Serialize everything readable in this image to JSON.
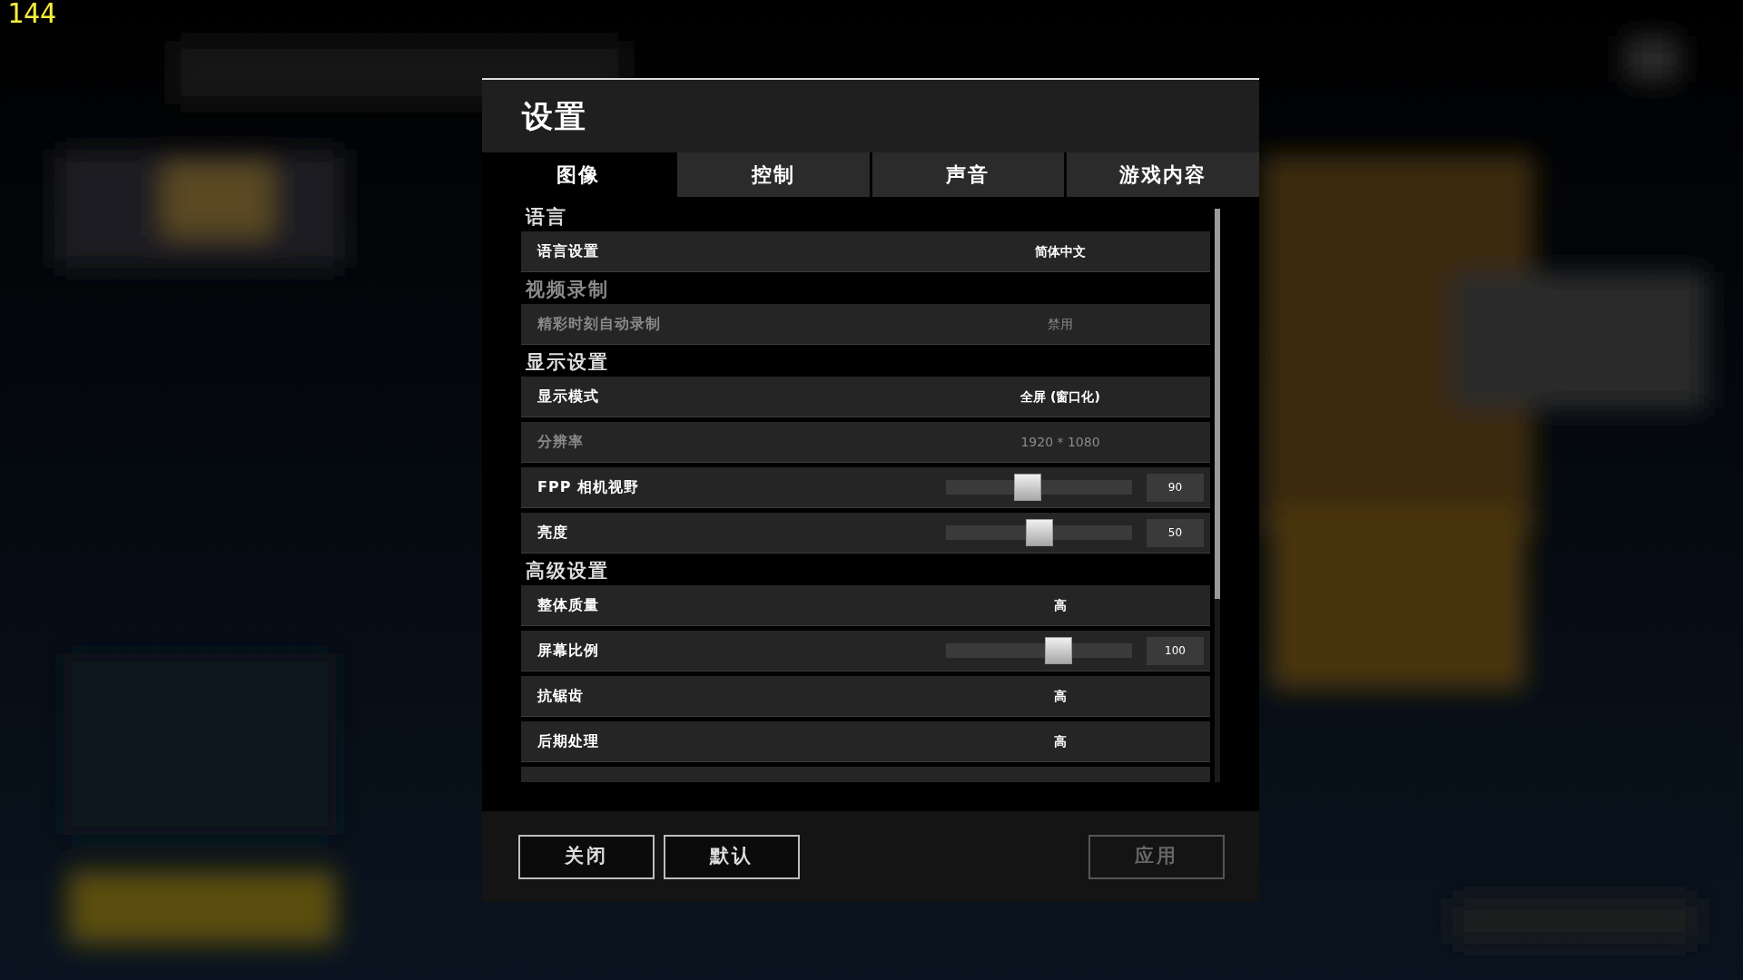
{
  "fps_counter": "144",
  "window": {
    "title": "设置"
  },
  "tabs": [
    {
      "label": "图像",
      "selected": true
    },
    {
      "label": "控制",
      "selected": false
    },
    {
      "label": "声音",
      "selected": false
    },
    {
      "label": "游戏内容",
      "selected": false
    }
  ],
  "sections": [
    {
      "title": "语言",
      "disabled": false,
      "rows": [
        {
          "kind": "select",
          "label": "语言设置",
          "value": "简体中文",
          "disabled": false
        }
      ]
    },
    {
      "title": "视频录制",
      "disabled": true,
      "rows": [
        {
          "kind": "select",
          "label": "精彩时刻自动录制",
          "value": "禁用",
          "disabled": true
        }
      ]
    },
    {
      "title": "显示设置",
      "disabled": false,
      "rows": [
        {
          "kind": "select",
          "label": "显示模式",
          "value": "全屏 (窗口化)",
          "disabled": false
        },
        {
          "kind": "select",
          "label": "分辨率",
          "value": "1920 * 1080",
          "disabled": true
        },
        {
          "kind": "slider",
          "label": "FPP 相机视野",
          "level": 0.43,
          "reading": "90",
          "disabled": false
        },
        {
          "kind": "slider",
          "label": "亮度",
          "level": 0.5,
          "reading": "50",
          "disabled": false
        }
      ]
    },
    {
      "title": "高级设置",
      "disabled": false,
      "rows": [
        {
          "kind": "select",
          "label": "整体质量",
          "value": "高",
          "disabled": false
        },
        {
          "kind": "slider",
          "label": "屏幕比例",
          "level": 0.62,
          "reading": "100",
          "disabled": false
        },
        {
          "kind": "select",
          "label": "抗锯齿",
          "value": "高",
          "disabled": false
        },
        {
          "kind": "select",
          "label": "后期处理",
          "value": "高",
          "disabled": false
        },
        {
          "kind": "cut"
        }
      ]
    }
  ],
  "buttons": [
    {
      "label": "关闭",
      "disabled": false
    },
    {
      "label": "默认",
      "disabled": false
    },
    {
      "label": "应用",
      "disabled": true
    }
  ]
}
